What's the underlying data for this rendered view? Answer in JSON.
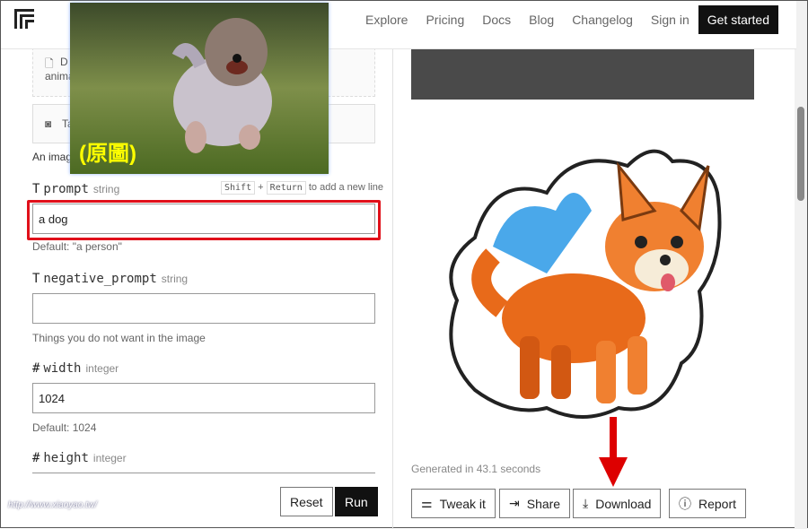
{
  "nav": {
    "links": [
      "Explore",
      "Pricing",
      "Docs",
      "Blog",
      "Changelog",
      "Sign in"
    ],
    "cta": "Get started"
  },
  "inset": {
    "label": "(原圖)"
  },
  "left": {
    "upload_partial": "D",
    "upload_desc_partial": "anima",
    "camera_partial": "Ta",
    "image_desc_partial": "An imag",
    "prompt": {
      "name": "prompt",
      "type": "string",
      "hint_key1": "Shift",
      "hint_plus": "+",
      "hint_key2": "Return",
      "hint_text": "to add a new line",
      "value": "a dog",
      "default": "Default: \"a person\""
    },
    "negative_prompt": {
      "name": "negative_prompt",
      "type": "string",
      "value": "",
      "desc": "Things you do not want in the image"
    },
    "width": {
      "name": "width",
      "type": "integer",
      "value": "1024",
      "default": "Default: 1024"
    },
    "height": {
      "name": "height",
      "type": "integer"
    },
    "reset": "Reset",
    "run": "Run"
  },
  "right": {
    "generated": "Generated in 43.1 seconds",
    "buttons": [
      "Tweak it",
      "Share",
      "Download",
      "Report"
    ]
  },
  "watermark": "http://www.xiaoyao.tw/",
  "colors": {
    "highlight": "#e0101a",
    "arrow": "#dd0000",
    "label": "#ffee00"
  }
}
